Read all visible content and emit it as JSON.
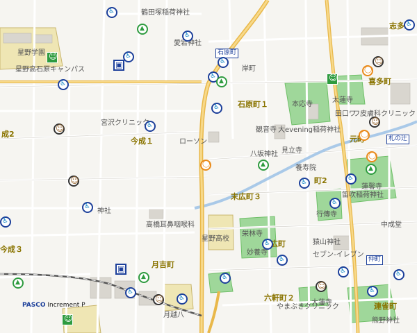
{
  "map": {
    "title": ""
  },
  "brand": {
    "name": "PASCO",
    "suffix": "Increment P"
  },
  "towns": [
    {
      "name": "志多町"
    },
    {
      "name": "石原町１"
    },
    {
      "name": "喜多町"
    },
    {
      "name": "元町"
    },
    {
      "name": "今成１"
    },
    {
      "name": "末広町３"
    },
    {
      "name": "月吉町"
    },
    {
      "name": "六軒町２"
    },
    {
      "name": "連雀町"
    },
    {
      "name": "成2"
    },
    {
      "name": "今成３"
    },
    {
      "name": "末広町"
    },
    {
      "name": "町2"
    }
  ],
  "labels": [
    {
      "text": "鶴田塚稲荷神社"
    },
    {
      "text": "愛宕神社"
    },
    {
      "text": "岸町"
    },
    {
      "text": "星野学園"
    },
    {
      "text": "星野高石原キャンパス"
    },
    {
      "text": "宮沢クリニック"
    },
    {
      "text": "ローソン"
    },
    {
      "text": "八坂神社"
    },
    {
      "text": "観音寺"
    },
    {
      "text": "大evening稲荷神社"
    },
    {
      "text": "見立寺"
    },
    {
      "text": "養寿院"
    },
    {
      "text": "高橋耳鼻咽喉科"
    },
    {
      "text": "星野高校"
    },
    {
      "text": "栄林寺"
    },
    {
      "text": "妙養寺"
    },
    {
      "text": "行傳寺"
    },
    {
      "text": "猿山神社"
    },
    {
      "text": "セブン-イレブン"
    },
    {
      "text": "神社"
    },
    {
      "text": "笛吹稲荷神社"
    },
    {
      "text": "月越八"
    },
    {
      "text": "大蓮寺"
    },
    {
      "text": "やまぶきクリニック"
    },
    {
      "text": "熊野神社"
    },
    {
      "text": "中成堂"
    },
    {
      "text": "蓮馨寺"
    },
    {
      "text": "本応寺"
    },
    {
      "text": "太蓮寺"
    },
    {
      "text": "田口ワ"
    },
    {
      "text": "ワ皮膚科"
    },
    {
      "text": "クリニック"
    }
  ],
  "stations": [
    {
      "name": "石原町"
    },
    {
      "name": "札の辻"
    },
    {
      "name": "仲町"
    }
  ]
}
